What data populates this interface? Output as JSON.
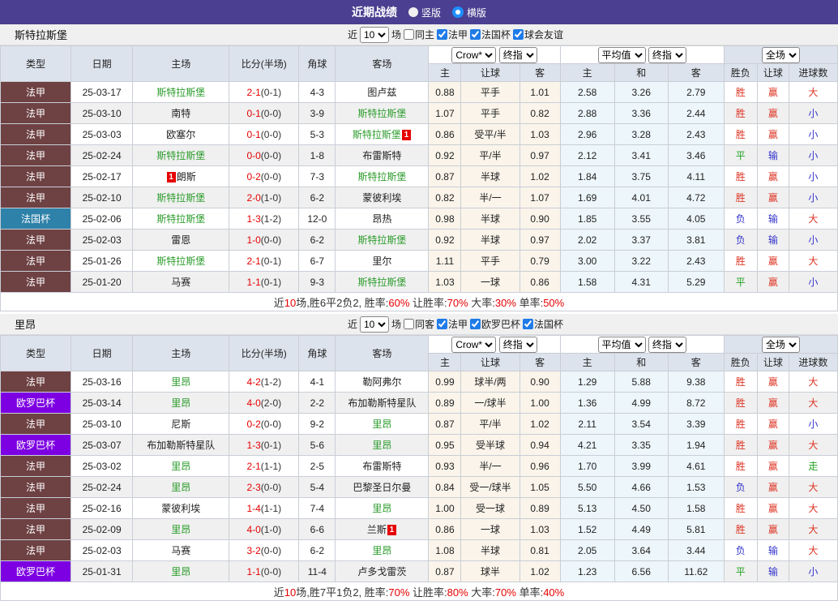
{
  "page": {
    "title": "近期战绩",
    "radio_vertical": "竖版",
    "radio_horizontal": "横版"
  },
  "ui": {
    "near": "近",
    "games": "场"
  },
  "columns": {
    "type": "类型",
    "date": "日期",
    "home": "主场",
    "score": "比分(半场)",
    "corner": "角球",
    "away": "客场",
    "dd_crow": "Crow*",
    "dd_final": "终指",
    "dd_avg": "平均值",
    "dd_full": "全场",
    "sub": [
      "主",
      "让球",
      "客",
      "主",
      "和",
      "客",
      "胜负",
      "让球",
      "进球数"
    ]
  },
  "colors": {
    "header_purple": "#4a3f90",
    "header_bg": "#dde3ed",
    "alt_row": "#f0f0f0",
    "odds_tint": "#faf4ea",
    "avg_tint": "#edf6fa",
    "score_red": "#e60000",
    "team_green": "#2c9c2c",
    "result_r": "#dd3322",
    "result_b": "#3333cc",
    "result_g": "#22a022",
    "type_colors": {
      "法甲": "#6e4143",
      "法国杯": "#2e81a8",
      "欧罗巴杯": "#7c00e2"
    }
  },
  "tables": [
    {
      "team": "斯特拉斯堡",
      "controls": {
        "count": "10",
        "same_label": "同主",
        "leagues": [
          "法甲",
          "法国杯",
          "球会友谊"
        ]
      },
      "rows": [
        {
          "type": "法甲",
          "date": "25-03-17",
          "home": {
            "n": "斯特拉斯堡",
            "g": true
          },
          "score": "2-1",
          "half": "(0-1)",
          "corner": "4-3",
          "away": {
            "n": "图卢兹"
          },
          "o1": [
            "0.88",
            "平手",
            "1.01"
          ],
          "o2": [
            "2.58",
            "3.26",
            "2.79"
          ],
          "res": [
            [
              "胜",
              "r"
            ],
            [
              "赢",
              "r"
            ],
            [
              "大",
              "r"
            ]
          ]
        },
        {
          "type": "法甲",
          "date": "25-03-10",
          "home": {
            "n": "南特"
          },
          "score": "0-1",
          "half": "(0-0)",
          "corner": "3-9",
          "away": {
            "n": "斯特拉斯堡",
            "g": true
          },
          "o1": [
            "1.07",
            "平手",
            "0.82"
          ],
          "o2": [
            "2.88",
            "3.36",
            "2.44"
          ],
          "res": [
            [
              "胜",
              "r"
            ],
            [
              "赢",
              "r"
            ],
            [
              "小",
              "b"
            ]
          ]
        },
        {
          "type": "法甲",
          "date": "25-03-03",
          "home": {
            "n": "欧塞尔"
          },
          "score": "0-1",
          "half": "(0-0)",
          "corner": "5-3",
          "away": {
            "n": "斯特拉斯堡",
            "g": true,
            "b_post": "1"
          },
          "o1": [
            "0.86",
            "受平/半",
            "1.03"
          ],
          "o2": [
            "2.96",
            "3.28",
            "2.43"
          ],
          "res": [
            [
              "胜",
              "r"
            ],
            [
              "赢",
              "r"
            ],
            [
              "小",
              "b"
            ]
          ]
        },
        {
          "type": "法甲",
          "date": "25-02-24",
          "home": {
            "n": "斯特拉斯堡",
            "g": true
          },
          "score": "0-0",
          "half": "(0-0)",
          "corner": "1-8",
          "away": {
            "n": "布雷斯特"
          },
          "o1": [
            "0.92",
            "平/半",
            "0.97"
          ],
          "o2": [
            "2.12",
            "3.41",
            "3.46"
          ],
          "res": [
            [
              "平",
              "g"
            ],
            [
              "输",
              "b"
            ],
            [
              "小",
              "b"
            ]
          ]
        },
        {
          "type": "法甲",
          "date": "25-02-17",
          "home": {
            "n": "朗斯",
            "b_pre": "1"
          },
          "score": "0-2",
          "half": "(0-0)",
          "corner": "7-3",
          "away": {
            "n": "斯特拉斯堡",
            "g": true
          },
          "o1": [
            "0.87",
            "半球",
            "1.02"
          ],
          "o2": [
            "1.84",
            "3.75",
            "4.11"
          ],
          "res": [
            [
              "胜",
              "r"
            ],
            [
              "赢",
              "r"
            ],
            [
              "小",
              "b"
            ]
          ]
        },
        {
          "type": "法甲",
          "date": "25-02-10",
          "home": {
            "n": "斯特拉斯堡",
            "g": true
          },
          "score": "2-0",
          "half": "(1-0)",
          "corner": "6-2",
          "away": {
            "n": "蒙彼利埃"
          },
          "o1": [
            "0.82",
            "半/一",
            "1.07"
          ],
          "o2": [
            "1.69",
            "4.01",
            "4.72"
          ],
          "res": [
            [
              "胜",
              "r"
            ],
            [
              "赢",
              "r"
            ],
            [
              "小",
              "b"
            ]
          ]
        },
        {
          "type": "法国杯",
          "date": "25-02-06",
          "home": {
            "n": "斯特拉斯堡",
            "g": true
          },
          "score": "1-3",
          "half": "(1-2)",
          "corner": "12-0",
          "away": {
            "n": "昂热"
          },
          "o1": [
            "0.98",
            "半球",
            "0.90"
          ],
          "o2": [
            "1.85",
            "3.55",
            "4.05"
          ],
          "res": [
            [
              "负",
              "b"
            ],
            [
              "输",
              "b"
            ],
            [
              "大",
              "r"
            ]
          ]
        },
        {
          "type": "法甲",
          "date": "25-02-03",
          "home": {
            "n": "雷恩"
          },
          "score": "1-0",
          "half": "(0-0)",
          "corner": "6-2",
          "away": {
            "n": "斯特拉斯堡",
            "g": true
          },
          "o1": [
            "0.92",
            "半球",
            "0.97"
          ],
          "o2": [
            "2.02",
            "3.37",
            "3.81"
          ],
          "res": [
            [
              "负",
              "b"
            ],
            [
              "输",
              "b"
            ],
            [
              "小",
              "b"
            ]
          ]
        },
        {
          "type": "法甲",
          "date": "25-01-26",
          "home": {
            "n": "斯特拉斯堡",
            "g": true
          },
          "score": "2-1",
          "half": "(0-1)",
          "corner": "6-7",
          "away": {
            "n": "里尔"
          },
          "o1": [
            "1.11",
            "平手",
            "0.79"
          ],
          "o2": [
            "3.00",
            "3.22",
            "2.43"
          ],
          "res": [
            [
              "胜",
              "r"
            ],
            [
              "赢",
              "r"
            ],
            [
              "大",
              "r"
            ]
          ]
        },
        {
          "type": "法甲",
          "date": "25-01-20",
          "home": {
            "n": "马赛"
          },
          "score": "1-1",
          "half": "(0-1)",
          "corner": "9-3",
          "away": {
            "n": "斯特拉斯堡",
            "g": true
          },
          "o1": [
            "1.03",
            "一球",
            "0.86"
          ],
          "o2": [
            "1.58",
            "4.31",
            "5.29"
          ],
          "res": [
            [
              "平",
              "g"
            ],
            [
              "赢",
              "r"
            ],
            [
              "小",
              "b"
            ]
          ]
        }
      ],
      "summary": [
        [
          "近",
          false
        ],
        [
          "10",
          true
        ],
        [
          "场,胜6平2负2, 胜率:",
          false
        ],
        [
          "60%",
          true
        ],
        [
          " 让胜率:",
          false
        ],
        [
          "70%",
          true
        ],
        [
          " 大率:",
          false
        ],
        [
          "30%",
          true
        ],
        [
          " 单率:",
          false
        ],
        [
          "50%",
          true
        ]
      ]
    },
    {
      "team": "里昂",
      "controls": {
        "count": "10",
        "same_label": "同客",
        "leagues": [
          "法甲",
          "欧罗巴杯",
          "法国杯"
        ]
      },
      "rows": [
        {
          "type": "法甲",
          "date": "25-03-16",
          "home": {
            "n": "里昂",
            "g": true
          },
          "score": "4-2",
          "half": "(1-2)",
          "corner": "4-1",
          "away": {
            "n": "勒阿弗尔"
          },
          "o1": [
            "0.99",
            "球半/两",
            "0.90"
          ],
          "o2": [
            "1.29",
            "5.88",
            "9.38"
          ],
          "res": [
            [
              "胜",
              "r"
            ],
            [
              "赢",
              "r"
            ],
            [
              "大",
              "r"
            ]
          ]
        },
        {
          "type": "欧罗巴杯",
          "date": "25-03-14",
          "home": {
            "n": "里昂",
            "g": true
          },
          "score": "4-0",
          "half": "(2-0)",
          "corner": "2-2",
          "away": {
            "n": "布加勒斯特星队"
          },
          "o1": [
            "0.89",
            "一/球半",
            "1.00"
          ],
          "o2": [
            "1.36",
            "4.99",
            "8.72"
          ],
          "res": [
            [
              "胜",
              "r"
            ],
            [
              "赢",
              "r"
            ],
            [
              "大",
              "r"
            ]
          ]
        },
        {
          "type": "法甲",
          "date": "25-03-10",
          "home": {
            "n": "尼斯"
          },
          "score": "0-2",
          "half": "(0-0)",
          "corner": "9-2",
          "away": {
            "n": "里昂",
            "g": true
          },
          "o1": [
            "0.87",
            "平/半",
            "1.02"
          ],
          "o2": [
            "2.11",
            "3.54",
            "3.39"
          ],
          "res": [
            [
              "胜",
              "r"
            ],
            [
              "赢",
              "r"
            ],
            [
              "小",
              "b"
            ]
          ]
        },
        {
          "type": "欧罗巴杯",
          "date": "25-03-07",
          "home": {
            "n": "布加勒斯特星队"
          },
          "score": "1-3",
          "half": "(0-1)",
          "corner": "5-6",
          "away": {
            "n": "里昂",
            "g": true
          },
          "o1": [
            "0.95",
            "受半球",
            "0.94"
          ],
          "o2": [
            "4.21",
            "3.35",
            "1.94"
          ],
          "res": [
            [
              "胜",
              "r"
            ],
            [
              "赢",
              "r"
            ],
            [
              "大",
              "r"
            ]
          ]
        },
        {
          "type": "法甲",
          "date": "25-03-02",
          "home": {
            "n": "里昂",
            "g": true
          },
          "score": "2-1",
          "half": "(1-1)",
          "corner": "2-5",
          "away": {
            "n": "布雷斯特"
          },
          "o1": [
            "0.93",
            "半/一",
            "0.96"
          ],
          "o2": [
            "1.70",
            "3.99",
            "4.61"
          ],
          "res": [
            [
              "胜",
              "r"
            ],
            [
              "赢",
              "r"
            ],
            [
              "走",
              "g"
            ]
          ]
        },
        {
          "type": "法甲",
          "date": "25-02-24",
          "home": {
            "n": "里昂",
            "g": true
          },
          "score": "2-3",
          "half": "(0-0)",
          "corner": "5-4",
          "away": {
            "n": "巴黎圣日尔曼"
          },
          "o1": [
            "0.84",
            "受一/球半",
            "1.05"
          ],
          "o2": [
            "5.50",
            "4.66",
            "1.53"
          ],
          "res": [
            [
              "负",
              "b"
            ],
            [
              "赢",
              "r"
            ],
            [
              "大",
              "r"
            ]
          ]
        },
        {
          "type": "法甲",
          "date": "25-02-16",
          "home": {
            "n": "蒙彼利埃"
          },
          "score": "1-4",
          "half": "(1-1)",
          "corner": "7-4",
          "away": {
            "n": "里昂",
            "g": true
          },
          "o1": [
            "1.00",
            "受一球",
            "0.89"
          ],
          "o2": [
            "5.13",
            "4.50",
            "1.58"
          ],
          "res": [
            [
              "胜",
              "r"
            ],
            [
              "赢",
              "r"
            ],
            [
              "大",
              "r"
            ]
          ]
        },
        {
          "type": "法甲",
          "date": "25-02-09",
          "home": {
            "n": "里昂",
            "g": true
          },
          "score": "4-0",
          "half": "(1-0)",
          "corner": "6-6",
          "away": {
            "n": "兰斯",
            "b_post": "1"
          },
          "o1": [
            "0.86",
            "一球",
            "1.03"
          ],
          "o2": [
            "1.52",
            "4.49",
            "5.81"
          ],
          "res": [
            [
              "胜",
              "r"
            ],
            [
              "赢",
              "r"
            ],
            [
              "大",
              "r"
            ]
          ]
        },
        {
          "type": "法甲",
          "date": "25-02-03",
          "home": {
            "n": "马赛"
          },
          "score": "3-2",
          "half": "(0-0)",
          "corner": "6-2",
          "away": {
            "n": "里昂",
            "g": true
          },
          "o1": [
            "1.08",
            "半球",
            "0.81"
          ],
          "o2": [
            "2.05",
            "3.64",
            "3.44"
          ],
          "res": [
            [
              "负",
              "b"
            ],
            [
              "输",
              "b"
            ],
            [
              "大",
              "r"
            ]
          ]
        },
        {
          "type": "欧罗巴杯",
          "date": "25-01-31",
          "home": {
            "n": "里昂",
            "g": true
          },
          "score": "1-1",
          "half": "(0-0)",
          "corner": "11-4",
          "away": {
            "n": "卢多戈雷茨"
          },
          "o1": [
            "0.87",
            "球半",
            "1.02"
          ],
          "o2": [
            "1.23",
            "6.56",
            "11.62"
          ],
          "res": [
            [
              "平",
              "g"
            ],
            [
              "输",
              "b"
            ],
            [
              "小",
              "b"
            ]
          ]
        }
      ],
      "summary": [
        [
          "近",
          false
        ],
        [
          "10",
          true
        ],
        [
          "场,胜7平1负2, 胜率:",
          false
        ],
        [
          "70%",
          true
        ],
        [
          " 让胜率:",
          false
        ],
        [
          "80%",
          true
        ],
        [
          " 大率:",
          false
        ],
        [
          "70%",
          true
        ],
        [
          " 单率:",
          false
        ],
        [
          "40%",
          true
        ]
      ]
    }
  ]
}
